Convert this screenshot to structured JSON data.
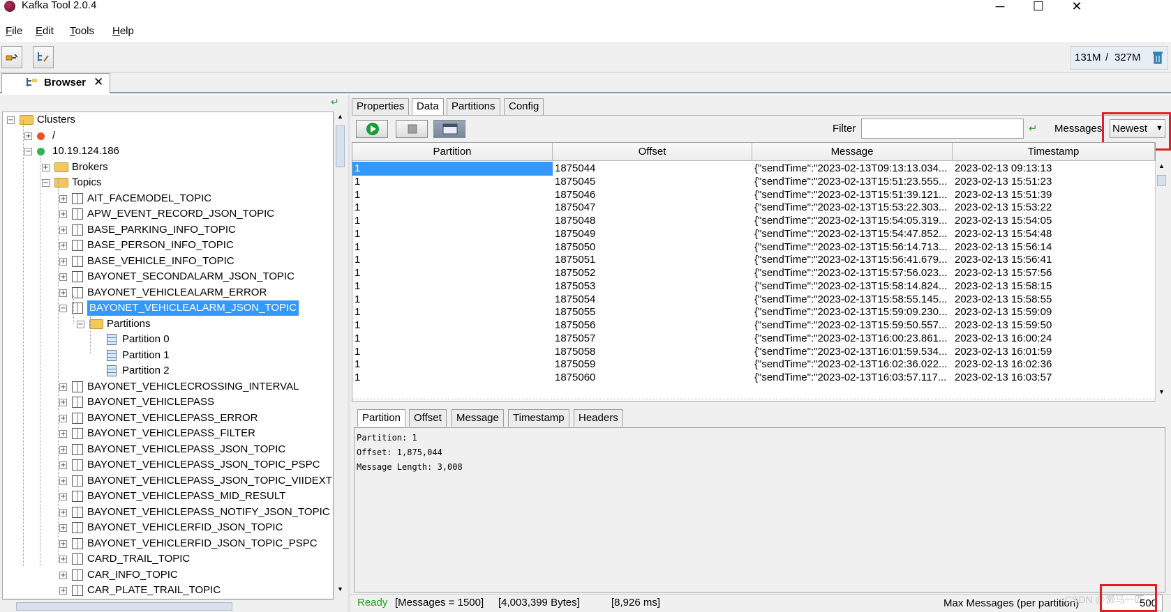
{
  "window": {
    "title": "Kafka Tool  2.0.4",
    "controls": {
      "minimize": "─",
      "maximize": "☐",
      "close": "✕"
    }
  },
  "menu": [
    {
      "label": "File",
      "key": "F",
      "rest": "ile"
    },
    {
      "label": "Edit",
      "key": "E",
      "rest": "dit"
    },
    {
      "label": "Tools",
      "key": "T",
      "rest": "ools"
    },
    {
      "label": "Help",
      "key": "H",
      "rest": "elp"
    }
  ],
  "toolbar": {
    "connect_icon": "plug-icon",
    "edit_icon": "edit-tree-icon",
    "memory_used": "131M",
    "memory_sep": "/",
    "memory_total": "327M",
    "gc_icon": "trash-icon"
  },
  "browser_tab": {
    "label": "Browser",
    "close": "✕"
  },
  "tree": [
    {
      "label": "Clusters",
      "type": "folder",
      "depth": 0,
      "expander": "−"
    },
    {
      "label": "/",
      "type": "cluster-offline",
      "depth": 1,
      "expander": "+"
    },
    {
      "label": "10.19.124.186",
      "type": "cluster-online",
      "depth": 1,
      "expander": "−"
    },
    {
      "label": "Brokers",
      "type": "folder",
      "depth": 2,
      "expander": "+"
    },
    {
      "label": "Topics",
      "type": "folder",
      "depth": 2,
      "expander": "−"
    },
    {
      "label": "AIT_FACEMODEL_TOPIC",
      "type": "topic",
      "depth": 3,
      "expander": "+"
    },
    {
      "label": "APW_EVENT_RECORD_JSON_TOPIC",
      "type": "topic",
      "depth": 3,
      "expander": "+"
    },
    {
      "label": "BASE_PARKING_INFO_TOPIC",
      "type": "topic",
      "depth": 3,
      "expander": "+"
    },
    {
      "label": "BASE_PERSON_INFO_TOPIC",
      "type": "topic",
      "depth": 3,
      "expander": "+"
    },
    {
      "label": "BASE_VEHICLE_INFO_TOPIC",
      "type": "topic",
      "depth": 3,
      "expander": "+"
    },
    {
      "label": "BAYONET_SECONDALARM_JSON_TOPIC",
      "type": "topic",
      "depth": 3,
      "expander": "+"
    },
    {
      "label": "BAYONET_VEHICLEALARM_ERROR",
      "type": "topic",
      "depth": 3,
      "expander": "+"
    },
    {
      "label": "BAYONET_VEHICLEALARM_JSON_TOPIC",
      "type": "topic",
      "depth": 3,
      "expander": "−",
      "selected": true
    },
    {
      "label": "Partitions",
      "type": "folder",
      "depth": 4,
      "expander": "−"
    },
    {
      "label": "Partition 0",
      "type": "partition",
      "depth": 5
    },
    {
      "label": "Partition 1",
      "type": "partition",
      "depth": 5
    },
    {
      "label": "Partition 2",
      "type": "partition",
      "depth": 5
    },
    {
      "label": "BAYONET_VEHICLECROSSING_INTERVAL",
      "type": "topic",
      "depth": 3,
      "expander": "+"
    },
    {
      "label": "BAYONET_VEHICLEPASS",
      "type": "topic",
      "depth": 3,
      "expander": "+"
    },
    {
      "label": "BAYONET_VEHICLEPASS_ERROR",
      "type": "topic",
      "depth": 3,
      "expander": "+"
    },
    {
      "label": "BAYONET_VEHICLEPASS_FILTER",
      "type": "topic",
      "depth": 3,
      "expander": "+"
    },
    {
      "label": "BAYONET_VEHICLEPASS_JSON_TOPIC",
      "type": "topic",
      "depth": 3,
      "expander": "+"
    },
    {
      "label": "BAYONET_VEHICLEPASS_JSON_TOPIC_PSPC",
      "type": "topic",
      "depth": 3,
      "expander": "+"
    },
    {
      "label": "BAYONET_VEHICLEPASS_JSON_TOPIC_VIIDEXT",
      "type": "topic",
      "depth": 3,
      "expander": "+"
    },
    {
      "label": "BAYONET_VEHICLEPASS_MID_RESULT",
      "type": "topic",
      "depth": 3,
      "expander": "+"
    },
    {
      "label": "BAYONET_VEHICLEPASS_NOTIFY_JSON_TOPIC",
      "type": "topic",
      "depth": 3,
      "expander": "+"
    },
    {
      "label": "BAYONET_VEHICLERFID_JSON_TOPIC",
      "type": "topic",
      "depth": 3,
      "expander": "+"
    },
    {
      "label": "BAYONET_VEHICLERFID_JSON_TOPIC_PSPC",
      "type": "topic",
      "depth": 3,
      "expander": "+"
    },
    {
      "label": "CARD_TRAIL_TOPIC",
      "type": "topic",
      "depth": 3,
      "expander": "+"
    },
    {
      "label": "CAR_INFO_TOPIC",
      "type": "topic",
      "depth": 3,
      "expander": "+"
    },
    {
      "label": "CAR_PLATE_TRAIL_TOPIC",
      "type": "topic",
      "depth": 3,
      "expander": "+"
    }
  ],
  "right_tabs": [
    "Properties",
    "Data",
    "Partitions",
    "Config"
  ],
  "right_active_tab": "Data",
  "data_toolbar": {
    "run_icon": "play-icon",
    "stop_icon": "stop-icon",
    "view_icon": "view-icon",
    "filter_label": "Filter",
    "filter_value": "",
    "filter_apply_icon": "apply-filter-icon",
    "messages_label": "Messages",
    "messages_value": "Newest",
    "messages_caret": "▼"
  },
  "table": {
    "columns": [
      "Partition",
      "Offset",
      "Message",
      "Timestamp"
    ],
    "rows": [
      [
        "1",
        "1875044",
        "{\"sendTime\":\"2023-02-13T09:13:13.034...",
        "2023-02-13 09:13:13"
      ],
      [
        "1",
        "1875045",
        "{\"sendTime\":\"2023-02-13T15:51:23.555...",
        "2023-02-13 15:51:23"
      ],
      [
        "1",
        "1875046",
        "{\"sendTime\":\"2023-02-13T15:51:39.121...",
        "2023-02-13 15:51:39"
      ],
      [
        "1",
        "1875047",
        "{\"sendTime\":\"2023-02-13T15:53:22.303...",
        "2023-02-13 15:53:22"
      ],
      [
        "1",
        "1875048",
        "{\"sendTime\":\"2023-02-13T15:54:05.319...",
        "2023-02-13 15:54:05"
      ],
      [
        "1",
        "1875049",
        "{\"sendTime\":\"2023-02-13T15:54:47.852...",
        "2023-02-13 15:54:48"
      ],
      [
        "1",
        "1875050",
        "{\"sendTime\":\"2023-02-13T15:56:14.713...",
        "2023-02-13 15:56:14"
      ],
      [
        "1",
        "1875051",
        "{\"sendTime\":\"2023-02-13T15:56:41.679...",
        "2023-02-13 15:56:41"
      ],
      [
        "1",
        "1875052",
        "{\"sendTime\":\"2023-02-13T15:57:56.023...",
        "2023-02-13 15:57:56"
      ],
      [
        "1",
        "1875053",
        "{\"sendTime\":\"2023-02-13T15:58:14.824...",
        "2023-02-13 15:58:15"
      ],
      [
        "1",
        "1875054",
        "{\"sendTime\":\"2023-02-13T15:58:55.145...",
        "2023-02-13 15:58:55"
      ],
      [
        "1",
        "1875055",
        "{\"sendTime\":\"2023-02-13T15:59:09.230...",
        "2023-02-13 15:59:09"
      ],
      [
        "1",
        "1875056",
        "{\"sendTime\":\"2023-02-13T15:59:50.557...",
        "2023-02-13 15:59:50"
      ],
      [
        "1",
        "1875057",
        "{\"sendTime\":\"2023-02-13T16:00:23.861...",
        "2023-02-13 16:00:24"
      ],
      [
        "1",
        "1875058",
        "{\"sendTime\":\"2023-02-13T16:01:59.534...",
        "2023-02-13 16:01:59"
      ],
      [
        "1",
        "1875059",
        "{\"sendTime\":\"2023-02-13T16:02:36.022...",
        "2023-02-13 16:02:36"
      ],
      [
        "1",
        "1875060",
        "{\"sendTime\":\"2023-02-13T16:03:57.117...",
        "2023-02-13 16:03:57"
      ]
    ],
    "selected_row": 0
  },
  "detail_tabs": [
    "Partition",
    "Offset",
    "Message",
    "Timestamp",
    "Headers"
  ],
  "detail_active_tab": "Partition",
  "detail_lines": [
    "Partition: 1",
    "Offset: 1,875,044",
    "Message Length: 3,008"
  ],
  "status": {
    "ready": "Ready",
    "messages": "[Messages = 1500]",
    "bytes": "[4,003,399 Bytes]",
    "ms": "[8,926 ms]",
    "max_label": "Max Messages (per partition)",
    "max_value": "500"
  },
  "watermark": "CSDN @懒马一匹",
  "colors": {
    "selection": "#3399ff",
    "highlight_box": "#e02020",
    "ready": "#1aa01a"
  }
}
